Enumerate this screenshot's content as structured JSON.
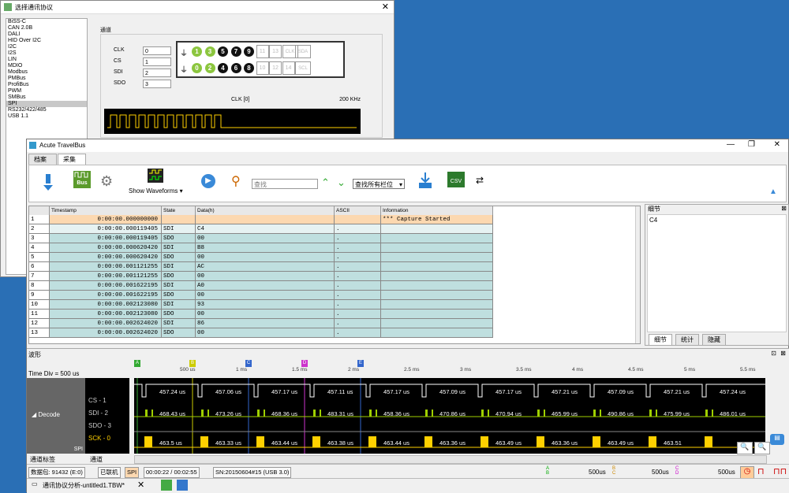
{
  "bg_dialog": {
    "title": "选择通讯协议",
    "protocols": [
      "BiSS-C",
      "CAN 2.0B",
      "DALI",
      "HID Over I2C",
      "I2C",
      "I2S",
      "LIN",
      "MDIO",
      "Modbus",
      "PMBus",
      "ProfiBus",
      "PWM",
      "SMBus",
      "SPI",
      "RS232/422/485",
      "USB 1.1"
    ],
    "selected_protocol": "SPI",
    "channel_label": "通道",
    "pins": [
      {
        "name": "CLK",
        "value": "0"
      },
      {
        "name": "CS",
        "value": "1"
      },
      {
        "name": "SDI",
        "value": "2"
      },
      {
        "name": "SDO",
        "value": "3"
      }
    ],
    "connector_top": [
      "1",
      "3",
      "5",
      "7",
      "9",
      "11",
      "13",
      "CLK",
      "SDA"
    ],
    "connector_bottom": [
      "0",
      "2",
      "4",
      "6",
      "8",
      "10",
      "12",
      "14",
      "SCL"
    ],
    "clk_label": "CLK [0]",
    "clk_freq": "200 KHz"
  },
  "window": {
    "title": "Acute TravelBus",
    "tabs": [
      "档案",
      "采集"
    ],
    "active_tab": "采集"
  },
  "ribbon": {
    "bus_label": "Bus",
    "show_waveforms": "Show Waveforms",
    "search_placeholder": "查找",
    "field_select": "查找所有栏位",
    "csv_label": "CSV"
  },
  "table": {
    "columns": [
      "Timestamp",
      "State",
      "Data(h)",
      "ASCII",
      "Information"
    ],
    "rows": [
      {
        "n": "1",
        "ts": "0:00:00.000000000",
        "state": "",
        "data": "",
        "ascii": "",
        "info": "*** Capture Started"
      },
      {
        "n": "2",
        "ts": "0:00:00.000119405",
        "state": "SDI",
        "data": "C4",
        "ascii": ".",
        "info": ""
      },
      {
        "n": "3",
        "ts": "0:00:00.000119405",
        "state": "SDO",
        "data": "00",
        "ascii": ".",
        "info": ""
      },
      {
        "n": "4",
        "ts": "0:00:00.000620420",
        "state": "SDI",
        "data": "B8",
        "ascii": ".",
        "info": ""
      },
      {
        "n": "5",
        "ts": "0:00:00.000620420",
        "state": "SDO",
        "data": "00",
        "ascii": ".",
        "info": ""
      },
      {
        "n": "6",
        "ts": "0:00:00.001121255",
        "state": "SDI",
        "data": "AC",
        "ascii": ".",
        "info": ""
      },
      {
        "n": "7",
        "ts": "0:00:00.001121255",
        "state": "SDO",
        "data": "00",
        "ascii": ".",
        "info": ""
      },
      {
        "n": "8",
        "ts": "0:00:00.001622195",
        "state": "SDI",
        "data": "A0",
        "ascii": ".",
        "info": ""
      },
      {
        "n": "9",
        "ts": "0:00:00.001622195",
        "state": "SDO",
        "data": "00",
        "ascii": ".",
        "info": ""
      },
      {
        "n": "10",
        "ts": "0:00:00.002123080",
        "state": "SDI",
        "data": "93",
        "ascii": ".",
        "info": ""
      },
      {
        "n": "11",
        "ts": "0:00:00.002123080",
        "state": "SDO",
        "data": "00",
        "ascii": ".",
        "info": ""
      },
      {
        "n": "12",
        "ts": "0:00:00.002624020",
        "state": "SDI",
        "data": "86",
        "ascii": ".",
        "info": ""
      },
      {
        "n": "13",
        "ts": "0:00:00.002624020",
        "state": "SDO",
        "data": "00",
        "ascii": ".",
        "info": ""
      }
    ]
  },
  "detail": {
    "title": "细节",
    "content": "C4",
    "tabs": [
      "细节",
      "统计",
      "隐藏"
    ]
  },
  "waveform": {
    "title": "波形",
    "time_div": "Time Div = 500 us",
    "ruler": [
      "500 us",
      "1 ms",
      "1.5 ms",
      "2 ms",
      "2.5 ms",
      "3 ms",
      "3.5 ms",
      "4 ms",
      "4.5 ms",
      "5 ms",
      "5.5 ms"
    ],
    "markers": [
      "A",
      "B",
      "C",
      "D",
      "E"
    ],
    "decode_label": "Decode",
    "decode_sub": "SPI",
    "channels": [
      "CS - 1",
      "SDI - 2",
      "SDO - 3",
      "SCK - 0"
    ],
    "cs_labels": [
      "457.24 us",
      "457.06 us",
      "457.17 us",
      "457.11 us",
      "457.17 us",
      "457.09 us",
      "457.17 us",
      "457.21 us",
      "457.09 us",
      "457.21 us",
      "457.24 us"
    ],
    "sdi_labels": [
      "468.43 us",
      "473.26 us",
      "468.36 us",
      "483.31 us",
      "458.36 us",
      "470.86 us",
      "470.94 us",
      "465.99 us",
      "490.86 us",
      "475.99 us",
      "486.01 us"
    ],
    "sck_labels": [
      "463.5 us",
      "463.33 us",
      "463.44 us",
      "463.38 us",
      "463.44 us",
      "463.36 us",
      "463.49 us",
      "463.36 us",
      "463.49 us",
      "463.51"
    ],
    "bottom_left": "通道标签",
    "bottom_right": "通道"
  },
  "status": {
    "packets": "数据包: 91432 (E:0)",
    "connected": "已联机",
    "mode": "SPI",
    "time": "00:00:22 / 00:02:55",
    "sn": "SN:20150604#15 (USB 3.0)",
    "delta_ab": "500us",
    "delta_bc": "500us",
    "delta_cd": "500us"
  },
  "taskbar": {
    "doc_tab": "通讯协议分析-untitled1.TBW*"
  },
  "colors": {
    "row_highlight": "#fcd8b0",
    "row_normal": "#bfdfdf",
    "row_sel": "#e6f2f2",
    "cs_line": "#ffffff",
    "sdi_green": "#a0d000",
    "sck_yellow": "#ffd000"
  }
}
